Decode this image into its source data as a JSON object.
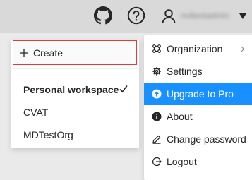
{
  "header": {
    "username": "mdtestadmin",
    "icons": [
      "github-icon",
      "help-icon",
      "user-icon",
      "caret-down-icon"
    ]
  },
  "workspace_menu": {
    "create_label": "Create",
    "items": [
      {
        "label": "Personal workspace",
        "selected": true
      },
      {
        "label": "CVAT",
        "selected": false
      },
      {
        "label": "MDTestOrg",
        "selected": false
      }
    ]
  },
  "user_menu": {
    "items": [
      {
        "label": "Organization",
        "icon": "organization-icon",
        "has_submenu": true
      },
      {
        "label": "Settings",
        "icon": "gear-icon"
      },
      {
        "label": "Upgrade to Pro",
        "icon": "upgrade-icon",
        "highlighted": true
      },
      {
        "label": "About",
        "icon": "info-icon"
      },
      {
        "label": "Change password",
        "icon": "edit-icon"
      },
      {
        "label": "Logout",
        "icon": "logout-icon"
      }
    ]
  },
  "colors": {
    "accent": "#1890ff",
    "create_border": "#e53935",
    "header_bg": "#d9d9d9",
    "page_bg": "#eaeaea"
  }
}
